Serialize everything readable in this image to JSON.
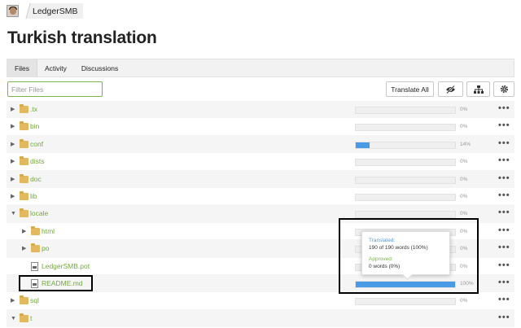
{
  "breadcrumb": {
    "project": "LedgerSMB"
  },
  "page": {
    "title": "Turkish translation"
  },
  "tabs": [
    {
      "label": "Files",
      "active": true
    },
    {
      "label": "Activity",
      "active": false
    },
    {
      "label": "Discussions",
      "active": false
    }
  ],
  "toolbar": {
    "filter_placeholder": "Filter Files",
    "translate_all_label": "Translate All",
    "icons": [
      "eye-slash-icon",
      "sitemap-icon",
      "gear-icon"
    ]
  },
  "files": [
    {
      "name": ".tx",
      "type": "folder",
      "expanded": false,
      "depth": 0,
      "progress": 0,
      "pct_label": "0%"
    },
    {
      "name": "bin",
      "type": "folder",
      "expanded": false,
      "depth": 0,
      "progress": 0,
      "pct_label": "0%"
    },
    {
      "name": "conf",
      "type": "folder",
      "expanded": false,
      "depth": 0,
      "progress": 0.14,
      "pct_label": "14%"
    },
    {
      "name": "dists",
      "type": "folder",
      "expanded": false,
      "depth": 0,
      "progress": 0,
      "pct_label": "0%"
    },
    {
      "name": "doc",
      "type": "folder",
      "expanded": false,
      "depth": 0,
      "progress": 0,
      "pct_label": "0%"
    },
    {
      "name": "lib",
      "type": "folder",
      "expanded": false,
      "depth": 0,
      "progress": 0,
      "pct_label": "0%"
    },
    {
      "name": "locale",
      "type": "folder",
      "expanded": true,
      "depth": 0,
      "progress": 0,
      "pct_label": "0%"
    },
    {
      "name": "html",
      "type": "folder",
      "expanded": false,
      "depth": 1,
      "progress": 0,
      "pct_label": "0%"
    },
    {
      "name": "po",
      "type": "folder",
      "expanded": false,
      "depth": 1,
      "progress": 0,
      "pct_label": "0%"
    },
    {
      "name": "LedgerSMB.pot",
      "type": "file",
      "depth": 1,
      "progress": 0,
      "pct_label": "0%"
    },
    {
      "name": "README.md",
      "type": "file",
      "depth": 1,
      "progress": 1,
      "pct_label": "100%"
    },
    {
      "name": "sql",
      "type": "folder",
      "expanded": false,
      "depth": 0,
      "progress": 0,
      "pct_label": "0%"
    },
    {
      "name": "t",
      "type": "folder",
      "expanded": true,
      "depth": 0,
      "progress": null,
      "pct_label": ""
    }
  ],
  "tooltip": {
    "translated_label": "Translated:",
    "translated_value": "190 of 190 words (100%)",
    "approved_label": "Approved:",
    "approved_value": "0 words (0%)"
  },
  "colors": {
    "accent_green": "#7ab648",
    "progress_blue": "#4a9be6",
    "folder": "#e2b95f"
  }
}
